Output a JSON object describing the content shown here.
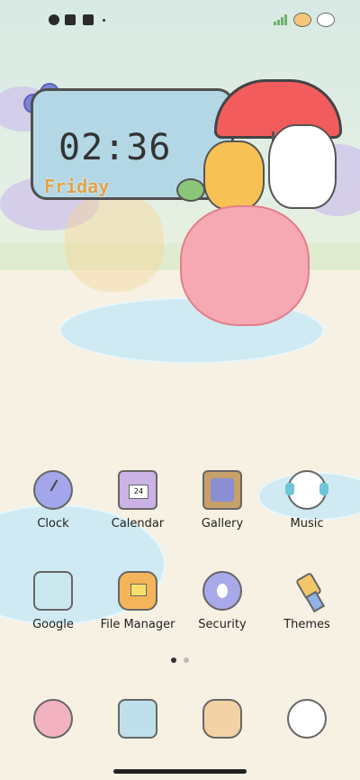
{
  "clock_widget": {
    "time": "02:36",
    "day": "Friday"
  },
  "apps_row1": [
    {
      "label": "Clock",
      "icon": "clock-icon"
    },
    {
      "label": "Calendar",
      "icon": "calendar-icon"
    },
    {
      "label": "Gallery",
      "icon": "gallery-icon"
    },
    {
      "label": "Music",
      "icon": "music-icon"
    }
  ],
  "apps_row2": [
    {
      "label": "Google",
      "icon": "google-folder-icon"
    },
    {
      "label": "File Manager",
      "icon": "file-manager-icon"
    },
    {
      "label": "Security",
      "icon": "security-icon"
    },
    {
      "label": "Themes",
      "icon": "themes-icon"
    }
  ],
  "calendar_icon_text": "24",
  "page_indicator": {
    "pages": 2,
    "active": 1
  },
  "dock": [
    "phone-cat-icon",
    "messages-cat-icon",
    "mail-cat-icon",
    "camera-cat-icon"
  ],
  "colors": {
    "widget_bg": "#b3d7e5",
    "day_text": "#e0a24a",
    "umbrella": "#f25c5c"
  }
}
